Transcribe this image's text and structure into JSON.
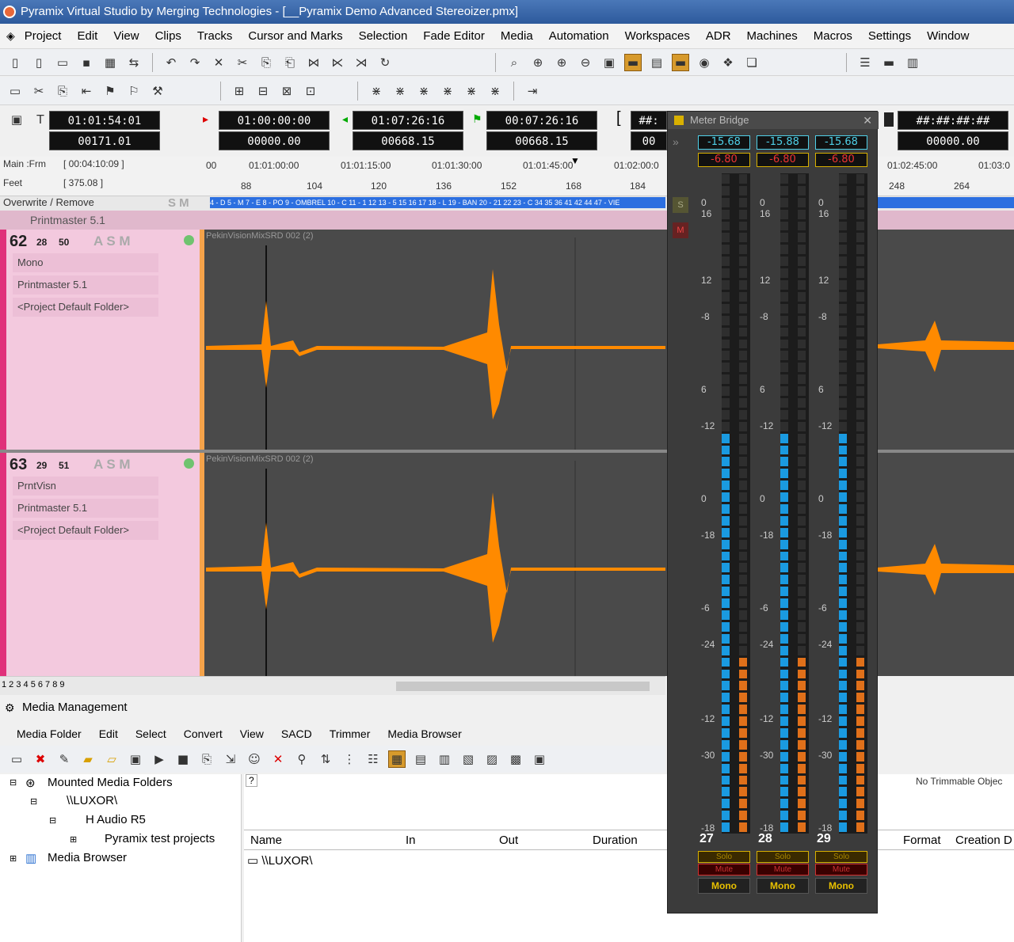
{
  "window": {
    "title": "Pyramix Virtual Studio by Merging Technologies - [__Pyramix Demo Advanced Stereoizer.pmx]"
  },
  "menu": [
    "Project",
    "Edit",
    "View",
    "Clips",
    "Tracks",
    "Cursor and Marks",
    "Selection",
    "Fade Editor",
    "Media",
    "Automation",
    "Workspaces",
    "ADR",
    "Machines",
    "Macros",
    "Settings",
    "Window"
  ],
  "timecodes": {
    "tc1": "01:01:54:01",
    "tc1b": "00171.01",
    "tc2": "01:00:00:00",
    "tc2b": "00000.00",
    "tc3": "01:07:26:16",
    "tc3b": "00668.15",
    "tc4": "00:07:26:16",
    "tc4b": "00668.15",
    "tc5": "##:",
    "tc5b": "00",
    "tc6": "##:##:##:##",
    "tc6b": "00000.00"
  },
  "ruler": {
    "label1": "Main :Frm",
    "value1": "[ 00:04:10:09 ]",
    "label2": "Feet",
    "value2": "[ 375.08 ]",
    "mode": "Overwrite / Remove",
    "sm": "S  M",
    "times": [
      "00",
      "01:01:00:00",
      "01:01:15:00",
      "01:01:30:00",
      "01:01:45:00",
      "01:02:00:0",
      "01:02:45:00",
      "01:03:0"
    ],
    "feet": [
      "88",
      "104",
      "120",
      "136",
      "152",
      "168",
      "184",
      "248",
      "264"
    ]
  },
  "clipbar_text": "4 - D 5 - M 7 - E 8 - PO 9 - OMBREL 10 - C 11 - 1 12 13 - 5 15 16 17 18 - L 19 - BAN 20 - 21 22 23 - C 34 35 36 41 42 44 47 - VIE",
  "group": {
    "name": "Printmaster 5.1"
  },
  "tracks": [
    {
      "num": "62",
      "a": "28",
      "b": "50",
      "flags": "A  S  M",
      "f1": "Mono",
      "f2": "Printmaster 5.1",
      "f3": "<Project Default Folder>",
      "clip": "PekinVisionMixSRD 002 (2)"
    },
    {
      "num": "63",
      "a": "29",
      "b": "51",
      "flags": "A  S  M",
      "f1": "PrntVisn",
      "f2": "Printmaster 5.1",
      "f3": "<Project Default Folder>",
      "clip": "PekinVisionMixSRD 002 (2)"
    }
  ],
  "bottom_tabs": "1 2 3 4 5 6 7 8 9",
  "media": {
    "title": "Media Management",
    "menu": [
      "Media Folder",
      "Edit",
      "Select",
      "Convert",
      "View",
      "SACD",
      "Trimmer",
      "Media Browser"
    ],
    "tree": [
      "Mounted Media Folders",
      "\\\\LUXOR\\",
      "H Audio R5",
      "Pyramix test projects",
      "Media Browser"
    ],
    "no_trimmable": "No Trimmable Objec",
    "columns": [
      "Name",
      "In",
      "Out",
      "Duration",
      "Format",
      "Creation D"
    ],
    "rows": [
      "\\\\LUXOR\\"
    ],
    "question": "?"
  },
  "meter": {
    "title": "Meter Bridge",
    "channels": [
      {
        "rms": "-15.68",
        "peak": "-6.80",
        "num": "27",
        "solo": "Solo",
        "mute": "Mute",
        "mode": "Mono",
        "level": 0.28
      },
      {
        "rms": "-15.88",
        "peak": "-6.80",
        "num": "28",
        "solo": "Solo",
        "mute": "Mute",
        "mode": "Mono",
        "level": 0.28
      },
      {
        "rms": "-15.68",
        "peak": "-6.80",
        "num": "29",
        "solo": "Solo",
        "mute": "Mute",
        "mode": "Mono",
        "level": 0.28
      }
    ],
    "scale": [
      "0",
      "16",
      "12",
      "-8",
      "6",
      "-12",
      "0",
      "-18",
      "-6",
      "-24",
      "-12",
      "-30",
      "-18"
    ],
    "side_letters": [
      "S",
      "M"
    ]
  },
  "colors": {
    "waveform": "#ff8a00",
    "track_head": "#f3c9de",
    "meter_blue": "#1a9ae0",
    "meter_orange": "#e0701a"
  }
}
